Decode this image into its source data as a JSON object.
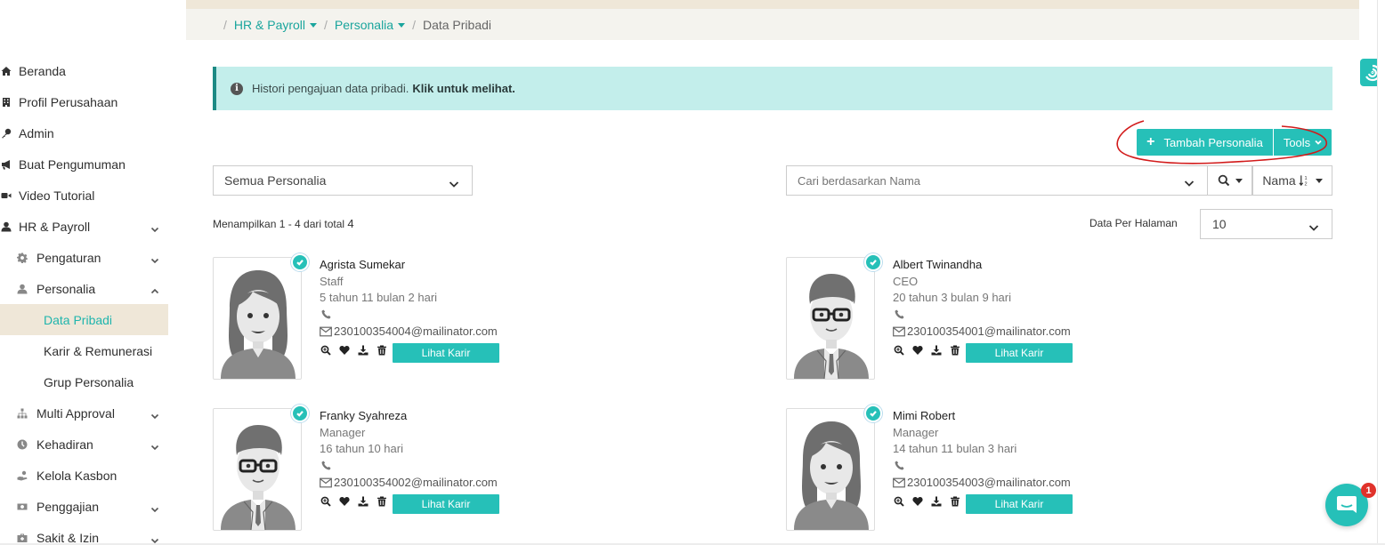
{
  "sidebar": {
    "items": [
      {
        "label": "Beranda",
        "icon": "home-icon"
      },
      {
        "label": "Profil Perusahaan",
        "icon": "building-icon"
      },
      {
        "label": "Admin",
        "icon": "key-icon"
      },
      {
        "label": "Buat Pengumuman",
        "icon": "megaphone-icon"
      },
      {
        "label": "Video Tutorial",
        "icon": "video-icon"
      },
      {
        "label": "HR & Payroll",
        "icon": "user-icon"
      },
      {
        "label": "Pengaturan",
        "icon": "gear-icon"
      },
      {
        "label": "Personalia",
        "icon": "user-icon"
      },
      {
        "label": "Data Pribadi"
      },
      {
        "label": "Karir & Remunerasi"
      },
      {
        "label": "Grup Personalia"
      },
      {
        "label": "Multi Approval",
        "icon": "sitemap-icon"
      },
      {
        "label": "Kehadiran",
        "icon": "clock-icon"
      },
      {
        "label": "Kelola Kasbon",
        "icon": "hand-money-icon"
      },
      {
        "label": "Penggajian",
        "icon": "money-icon"
      },
      {
        "label": "Sakit & Izin",
        "icon": "medkit-icon"
      }
    ]
  },
  "breadcrumb": {
    "items": [
      "HR & Payroll",
      "Personalia",
      "Data Pribadi"
    ]
  },
  "alert": {
    "text": "Histori pengajuan data pribadi.",
    "link": "Klik untuk melihat."
  },
  "toolbar": {
    "add_label": "Tambah Personalia",
    "tools_label": "Tools"
  },
  "filter": {
    "selected": "Semua Personalia"
  },
  "search": {
    "placeholder": "Cari berdasarkan Nama",
    "sort_label": "Nama"
  },
  "listing": {
    "showing_text": "Menampilkan 1 - 4 dari total",
    "total": "4",
    "per_page_label": "Data Per Halaman",
    "per_page_value": "10"
  },
  "cards": [
    {
      "name": "Agrista Sumekar",
      "role": "Staff",
      "duration": "5 tahun 11 bulan 2 hari",
      "email": "230100354004@mailinator.com",
      "button": "Lihat Karir",
      "avatar": "female"
    },
    {
      "name": "Albert Twinandha",
      "role": "CEO",
      "duration": "20 tahun 3 bulan 9 hari",
      "email": "230100354001@mailinator.com",
      "button": "Lihat Karir",
      "avatar": "male"
    },
    {
      "name": "Franky Syahreza",
      "role": "Manager",
      "duration": "16 tahun 10 hari",
      "email": "230100354002@mailinator.com",
      "button": "Lihat Karir",
      "avatar": "male"
    },
    {
      "name": "Mimi Robert",
      "role": "Manager",
      "duration": "14 tahun 11 bulan 3 hari",
      "email": "230100354003@mailinator.com",
      "button": "Lihat Karir",
      "avatar": "female"
    }
  ],
  "chat": {
    "badge": "1"
  },
  "colors": {
    "accent": "#26c0b8",
    "active_bg": "#efe7d8",
    "alert_bg": "#c3eeeb",
    "badge": "#e0322b"
  }
}
